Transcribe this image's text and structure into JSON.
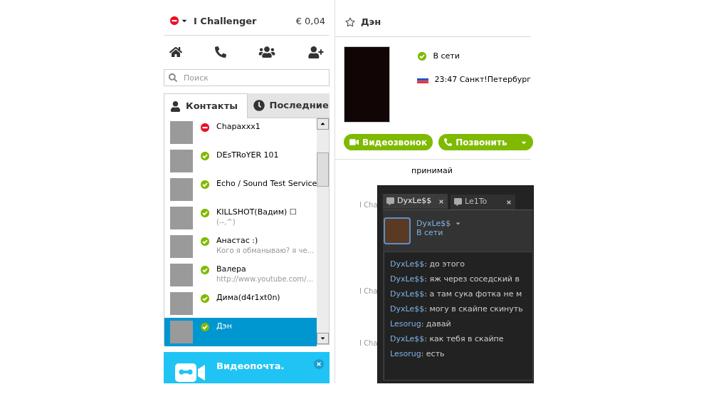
{
  "account": {
    "online": false,
    "name": "I Challenger",
    "balance": "€ 0,04"
  },
  "search": {
    "placeholder": "Поиск"
  },
  "tabs": [
    {
      "label": "Контакты",
      "selected": true
    },
    {
      "label": "Последние",
      "selected": false
    }
  ],
  "contacts": [
    {
      "name": "Chapaxxx1",
      "online": false,
      "selected": false
    },
    {
      "name": "DEsTRoYER 101",
      "online": true,
      "selected": false
    },
    {
      "name": "Echo / Sound Test Service",
      "online": true,
      "selected": false
    },
    {
      "name": "KILLSHOT(Вадим) ☐",
      "mood": "(--,^)",
      "online": true,
      "selected": false
    },
    {
      "name": "Анастас :)",
      "mood": "Кого я обманываю? я че...",
      "online": true,
      "selected": false
    },
    {
      "name": "Валера",
      "mood": "http://www.youtube.com/...",
      "online": true,
      "selected": false
    },
    {
      "name": "Дима(d4r1xt0n)",
      "online": true,
      "selected": false
    },
    {
      "name": "Дэн",
      "online": true,
      "selected": true
    }
  ],
  "promo": {
    "title": "Видеопочта."
  },
  "profile": {
    "name": "Дэн",
    "online": true,
    "status_text": "В сети",
    "local_info": "23:47 Санкт!Петербург",
    "buttons": [
      {
        "label": "Видеозвонок",
        "kind": "video"
      },
      {
        "label": "Позвонить",
        "kind": "call"
      }
    ]
  },
  "conversation": {
    "message": "принимай",
    "senders": [
      "I Cha",
      "I Cha",
      "I Cha"
    ]
  },
  "chat_window": {
    "tabs": [
      {
        "label": "DyxLe$$",
        "selected": true
      },
      {
        "label": "Le1To",
        "selected": false
      }
    ],
    "contact_name": "DyxLe$$",
    "contact_status": "В сети",
    "messages": [
      {
        "author": "DyxLe$$",
        "text": ": до этого"
      },
      {
        "author": "DyxLe$$",
        "text": ": яж через соседский в"
      },
      {
        "author": "DyxLe$$",
        "text": ": а там сука фотка не м"
      },
      {
        "author": "DyxLe$$",
        "text": ": могу в скайпе скинуть"
      },
      {
        "author": "Lesorug",
        "text": ": давай"
      },
      {
        "author": "DyxLe$$",
        "text": ": как тебя в скайпе"
      },
      {
        "author": "Lesorug",
        "text": ": есть"
      }
    ]
  }
}
